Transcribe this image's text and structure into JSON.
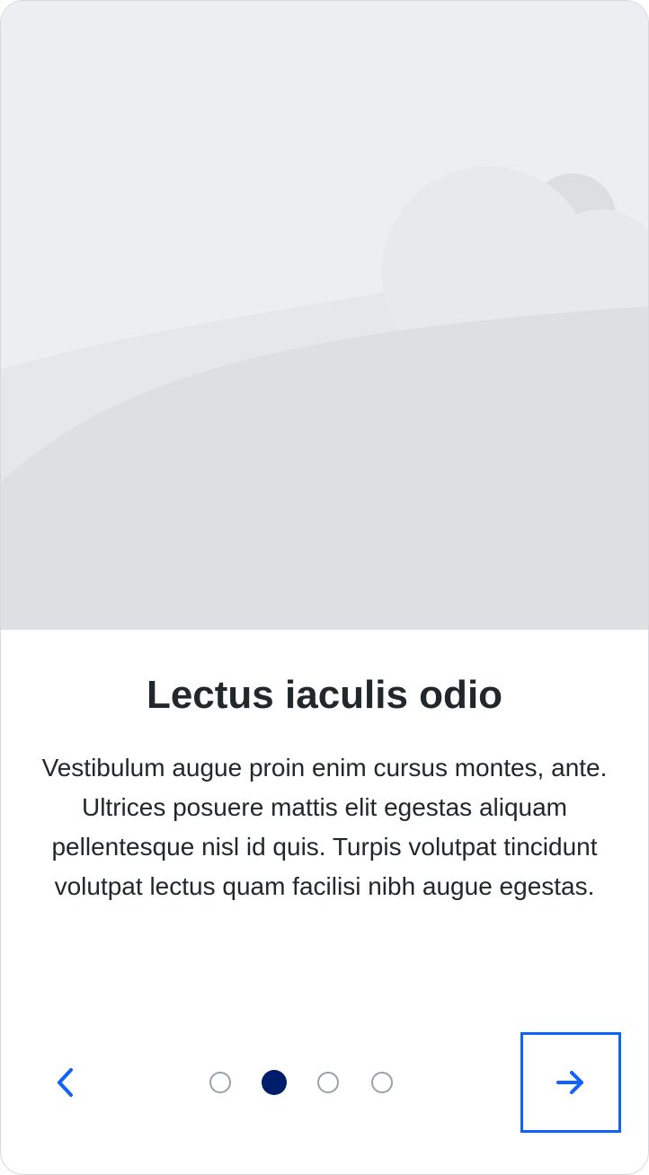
{
  "slide": {
    "title": "Lectus iaculis odio",
    "body": "Vestibulum augue proin enim cursus montes, ante. Ultrices posuere mattis elit egestas aliquam pellentesque nisl id quis. Turpis volutpat tincidunt volutpat lectus quam facilisi nibh augue egestas."
  },
  "pagination": {
    "total": 4,
    "current": 2
  },
  "icons": {
    "previous": "chevron-left-icon",
    "next": "arrow-right-icon",
    "hero": "placeholder-illustration"
  },
  "colors": {
    "accent": "#0f62fe",
    "active_dot": "#001d6c",
    "inactive_dot": "#9aa0a8",
    "text": "#21272a"
  }
}
